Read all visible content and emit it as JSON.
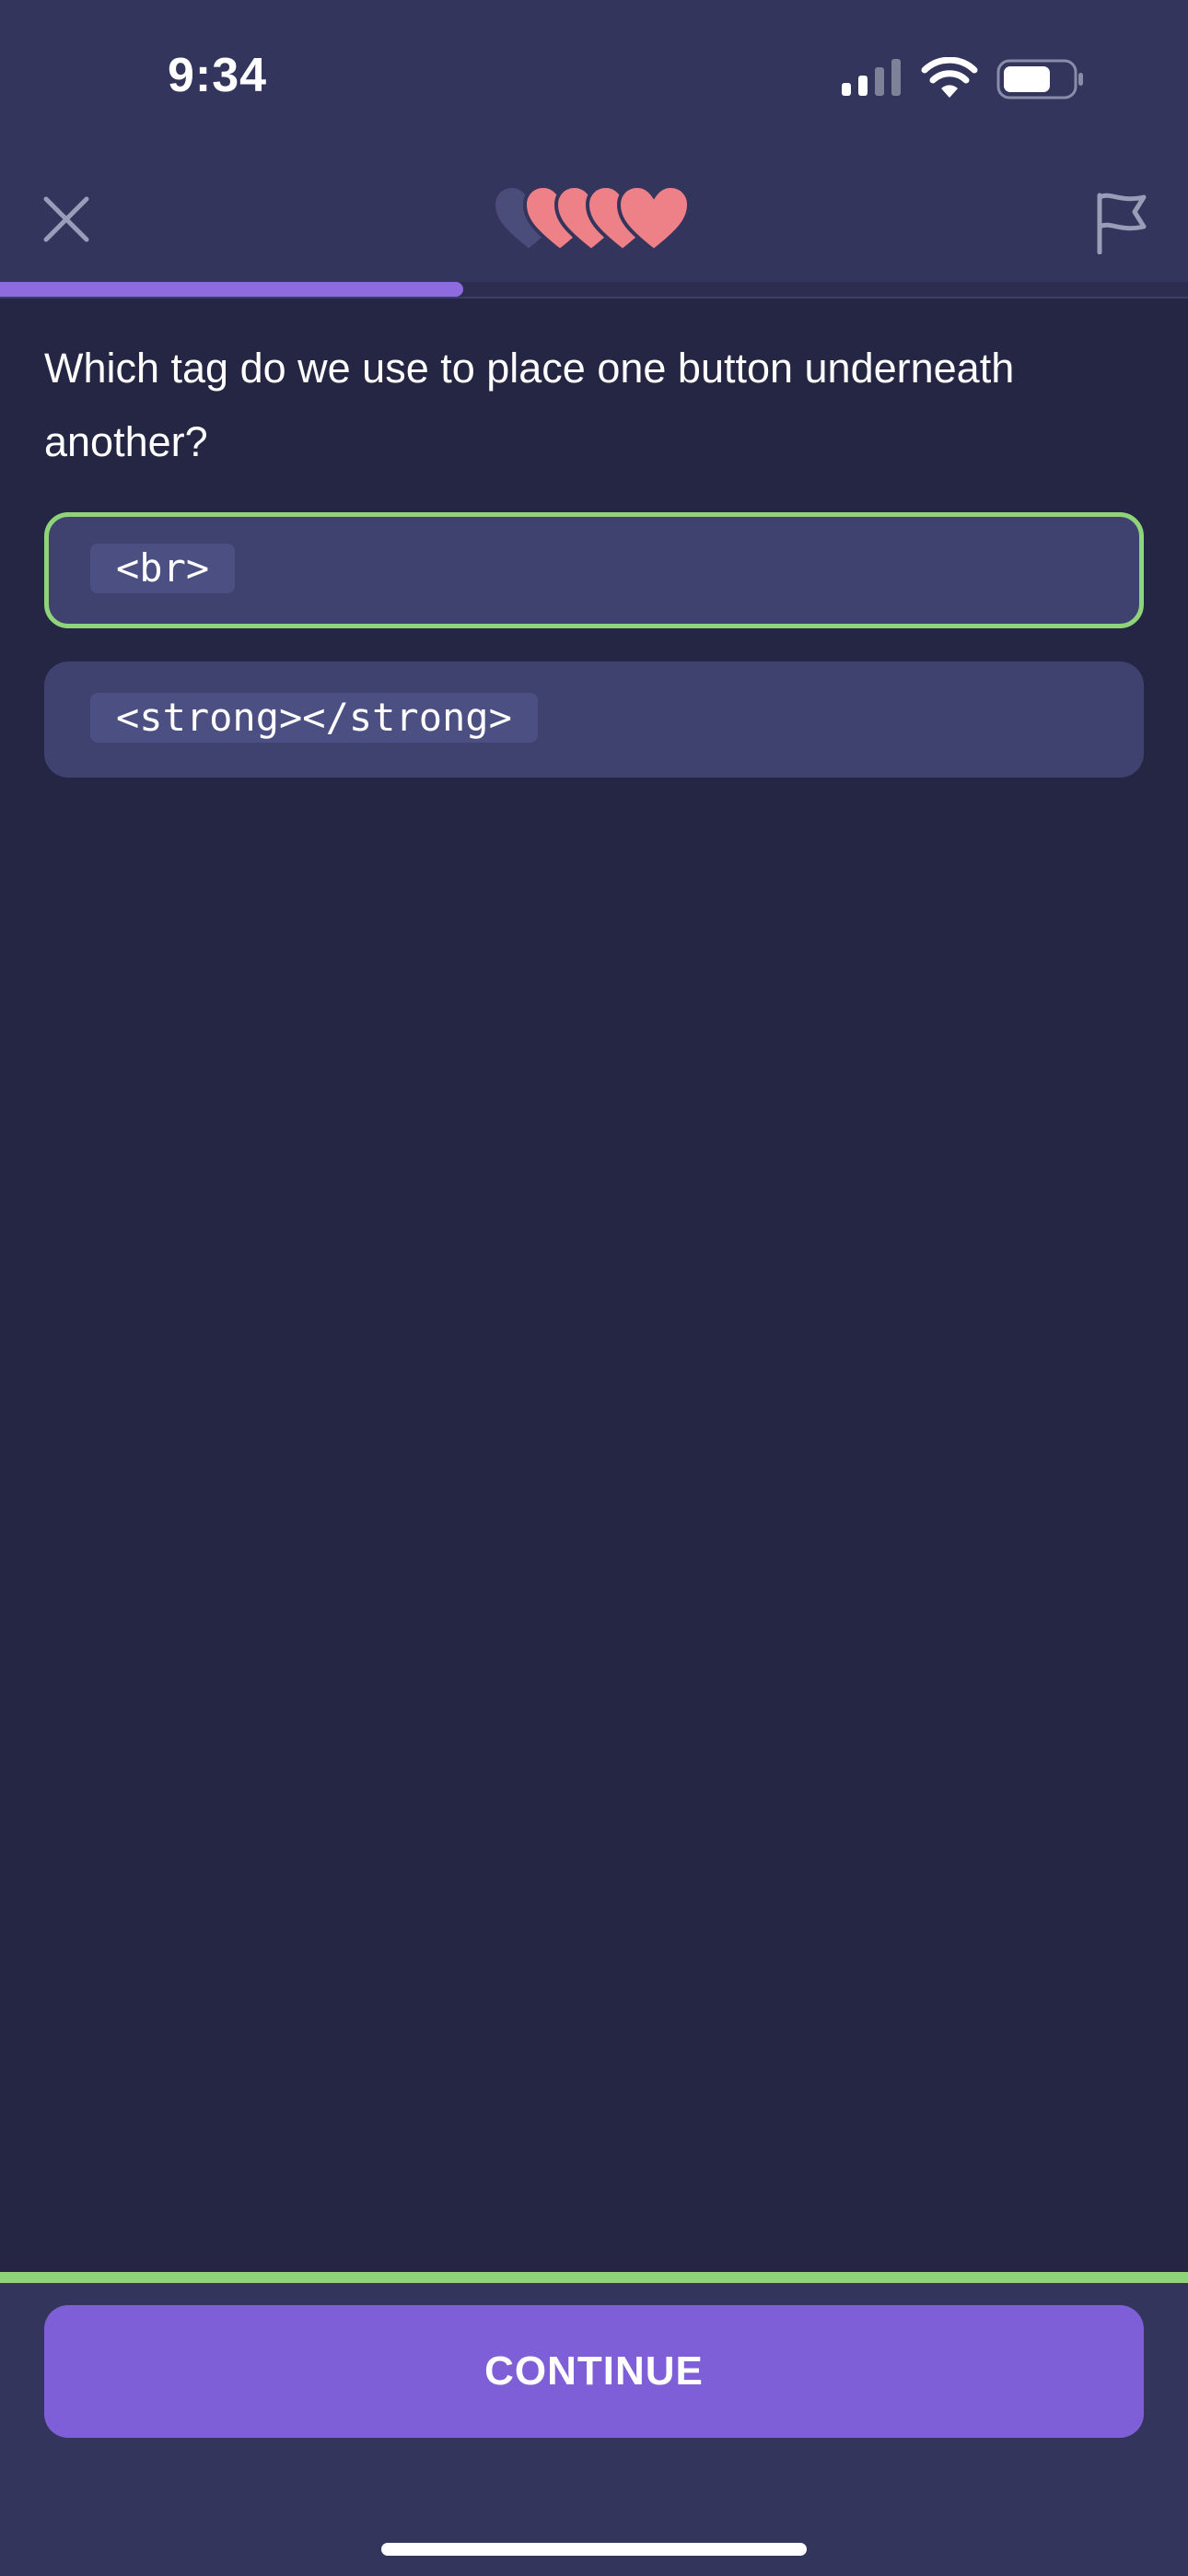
{
  "status_bar": {
    "time": "9:34"
  },
  "header": {
    "close_icon": "close-icon",
    "flag_icon": "flag-icon",
    "hearts": {
      "total": 5,
      "filled": 4
    },
    "progress": 0.39
  },
  "question": {
    "text": "Which tag do we use to place one button underneath another?"
  },
  "options": [
    {
      "label": "<br>",
      "selected": true
    },
    {
      "label": "<strong></strong>",
      "selected": false
    }
  ],
  "footer": {
    "continue_label": "CONTINUE"
  },
  "colors": {
    "background": "#252643",
    "header": "#33355c",
    "accent": "#7f5fd7",
    "progress": "#8e6ce0",
    "correct": "#8fd47a",
    "heart": "#ee8088",
    "heart_empty": "#4a4c7a",
    "option_bg": "#3f416e"
  }
}
